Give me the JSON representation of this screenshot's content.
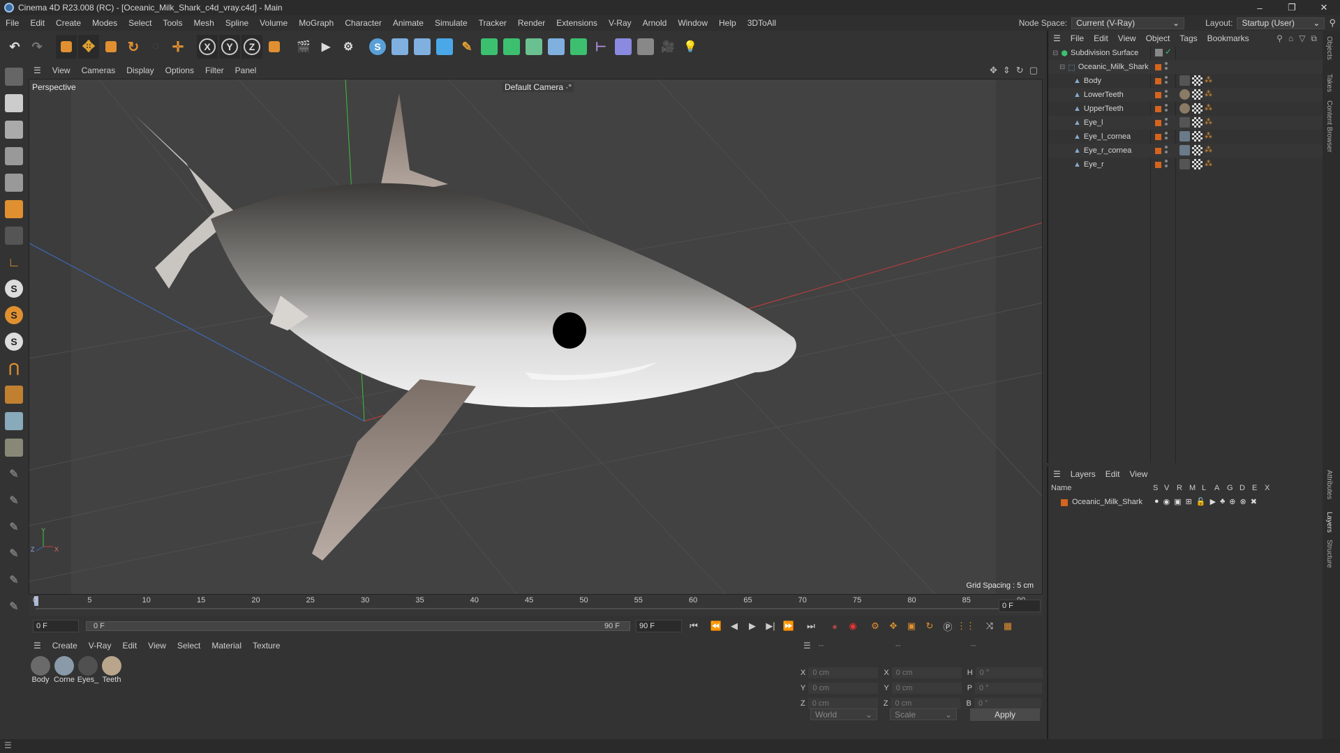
{
  "window": {
    "title": "Cinema 4D R23.008 (RC) - [Oceanic_Milk_Shark_c4d_vray.c4d] - Main",
    "controls": [
      "–",
      "❐",
      "✕"
    ]
  },
  "menubar": {
    "items": [
      "File",
      "Edit",
      "Create",
      "Modes",
      "Select",
      "Tools",
      "Mesh",
      "Spline",
      "Volume",
      "MoGraph",
      "Character",
      "Animate",
      "Simulate",
      "Tracker",
      "Render",
      "Extensions",
      "V-Ray",
      "Arnold",
      "Window",
      "Help",
      "3DToAll"
    ],
    "node_space_label": "Node Space:",
    "node_space_value": "Current (V-Ray)",
    "layout_label": "Layout:",
    "layout_value": "Startup (User)"
  },
  "toolbar": {
    "axis_x": "X",
    "axis_y": "Y",
    "axis_z": "Z"
  },
  "viewport": {
    "menu": [
      "View",
      "Cameras",
      "Display",
      "Options",
      "Filter",
      "Panel"
    ],
    "label": "Perspective",
    "camera": "Default Camera",
    "camera_glyph": "·°",
    "grid_spacing": "Grid Spacing : 5 cm",
    "axis_y": "Y",
    "axis_z": "Z",
    "axis_x": "X"
  },
  "timeline": {
    "ticks": [
      "0",
      "5",
      "10",
      "15",
      "20",
      "25",
      "30",
      "35",
      "40",
      "45",
      "50",
      "55",
      "60",
      "65",
      "70",
      "75",
      "80",
      "85",
      "90"
    ],
    "current_frame": "0 F"
  },
  "transport": {
    "start_frame": "0 F",
    "range_start": "0 F",
    "range_end": "90 F",
    "end_frame": "90 F"
  },
  "materials": {
    "menu": [
      "Create",
      "V-Ray",
      "Edit",
      "View",
      "Select",
      "Material",
      "Texture"
    ],
    "items": [
      {
        "label": "Body",
        "color": "#6a6a6a"
      },
      {
        "label": "Corne",
        "color": "#8a9aa8"
      },
      {
        "label": "Eyes_",
        "color": "#505050"
      },
      {
        "label": "Teeth",
        "color": "#b9a58c"
      }
    ]
  },
  "coords": {
    "header": [
      "--",
      "--",
      "--"
    ],
    "rows": [
      {
        "a": "X",
        "av": "0 cm",
        "b": "X",
        "bv": "0 cm",
        "c": "H",
        "cv": "0 °"
      },
      {
        "a": "Y",
        "av": "0 cm",
        "b": "Y",
        "bv": "0 cm",
        "c": "P",
        "cv": "0 °"
      },
      {
        "a": "Z",
        "av": "0 cm",
        "b": "Z",
        "bv": "0 cm",
        "c": "B",
        "cv": "0 °"
      }
    ],
    "space": "World",
    "mode": "Scale",
    "apply": "Apply"
  },
  "objects": {
    "menu": [
      "File",
      "Edit",
      "View",
      "Object",
      "Tags",
      "Bookmarks"
    ],
    "rows": [
      {
        "name": "Subdivision Surface",
        "indent": 0
      },
      {
        "name": "Oceanic_Milk_Shark",
        "indent": 1
      },
      {
        "name": "Body",
        "indent": 2
      },
      {
        "name": "LowerTeeth",
        "indent": 2
      },
      {
        "name": "UpperTeeth",
        "indent": 2
      },
      {
        "name": "Eye_l",
        "indent": 2
      },
      {
        "name": "Eye_l_cornea",
        "indent": 2
      },
      {
        "name": "Eye_r_cornea",
        "indent": 2
      },
      {
        "name": "Eye_r",
        "indent": 2
      }
    ]
  },
  "layers": {
    "menu": [
      "Layers",
      "Edit",
      "View"
    ],
    "columns": [
      "Name",
      "S",
      "V",
      "R",
      "M",
      "L",
      "A",
      "G",
      "D",
      "E",
      "X"
    ],
    "rows": [
      {
        "name": "Oceanic_Milk_Shark",
        "color": "#d4641e"
      }
    ]
  },
  "side_tabs": [
    "Objects",
    "Takes",
    "Content Browser",
    "Attributes",
    "Layers",
    "Structure"
  ],
  "colors": {
    "accent_orange": "#d4641e",
    "axis_x": "#c83c3c",
    "axis_y": "#3cc83c",
    "axis_z": "#3c6ec8"
  }
}
